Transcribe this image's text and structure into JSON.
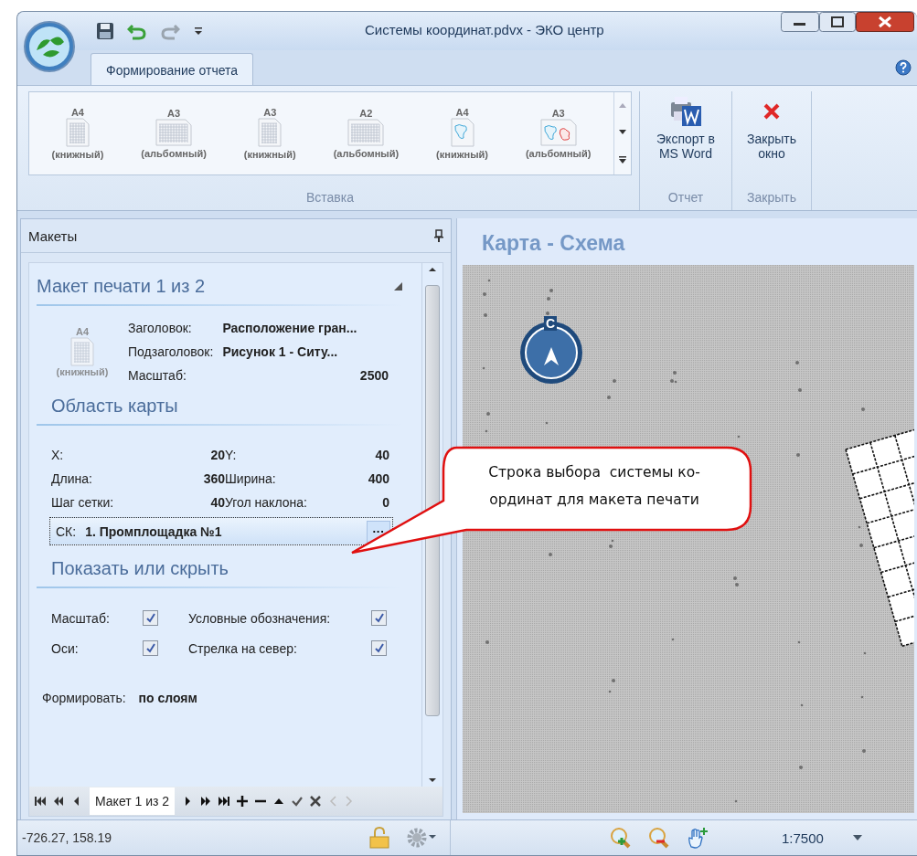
{
  "window": {
    "title": "Системы координат.pdvx - ЭКО центр"
  },
  "ribbon": {
    "tabs": [
      {
        "label": "Формирование отчета",
        "selected": true
      }
    ],
    "gallery": {
      "label": "Вставка",
      "items": [
        {
          "size": "A4",
          "orientation": "(книжный)",
          "kind": "portrait-grid"
        },
        {
          "size": "A3",
          "orientation": "(альбомный)",
          "kind": "landscape-grid"
        },
        {
          "size": "A3",
          "orientation": "(книжный)",
          "kind": "portrait-grid"
        },
        {
          "size": "A2",
          "orientation": "(альбомный)",
          "kind": "landscape-grid"
        },
        {
          "size": "A4",
          "orientation": "(книжный)",
          "kind": "portrait-map"
        },
        {
          "size": "A3",
          "orientation": "(альбомный)",
          "kind": "landscape-map"
        }
      ]
    },
    "groups": [
      {
        "kind": "export",
        "button": "Экспорт в MS Word",
        "label": "Отчет"
      },
      {
        "kind": "close",
        "button": "Закрыть окно",
        "label": "Закрыть"
      }
    ]
  },
  "layouts_panel": {
    "title": "Макеты",
    "section_title": "Макет печати 1 из 2",
    "page": {
      "size": "A4",
      "orientation": "(книжный)"
    },
    "fields": [
      {
        "label": "Заголовок:",
        "value": "Расположение гран..."
      },
      {
        "label": "Подзаголовок:",
        "value": "Рисунок 1 - Ситу..."
      },
      {
        "label": "Масштаб:",
        "value": "2500"
      }
    ],
    "map_area": {
      "title": "Область карты",
      "fields": [
        {
          "label": "X:",
          "value": "20"
        },
        {
          "label": "Y:",
          "value": "40"
        },
        {
          "label": "Длина:",
          "value": "360"
        },
        {
          "label": "Ширина:",
          "value": "400"
        },
        {
          "label": "Шаг сетки:",
          "value": "40"
        },
        {
          "label": "Угол наклона:",
          "value": "0"
        }
      ],
      "coordinate_system": {
        "label": "СК:",
        "value": "1. Промплощадка №1",
        "button": "···"
      }
    },
    "visibility": {
      "title": "Показать или скрыть",
      "options": [
        {
          "label": "Масштаб:",
          "checked": true
        },
        {
          "label": "Условные обозначения:",
          "checked": true
        },
        {
          "label": "Оси:",
          "checked": true
        },
        {
          "label": "Стрелка на север:",
          "checked": true
        }
      ]
    },
    "build": {
      "label": "Формировать:",
      "value": "по слоям"
    },
    "navigator": {
      "text": "Макет 1 из 2"
    }
  },
  "map": {
    "title": "Карта - Схема",
    "compass_letter": "С"
  },
  "callout": {
    "lines": [
      "Строка выбора  системы ко-",
      "ординат для макета печати"
    ]
  },
  "status_bar": {
    "coordinates": "-726.27, 158.19",
    "scale": "1:7500"
  }
}
